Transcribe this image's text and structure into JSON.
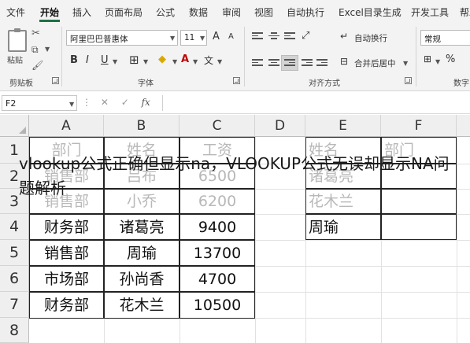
{
  "menu": {
    "tabs": [
      "文件",
      "开始",
      "插入",
      "页面布局",
      "公式",
      "数据",
      "审阅",
      "视图",
      "自动执行",
      "Excel目录生成",
      "开发工具",
      "帮助"
    ],
    "active_tab": "开始"
  },
  "ribbon": {
    "clipboard": {
      "paste_label": "粘贴",
      "group_label": "剪贴板"
    },
    "font": {
      "font_name": "阿里巴巴普惠体",
      "font_size": "11",
      "grow_label": "A",
      "shrink_label": "A",
      "bold": "B",
      "italic": "I",
      "underline": "U",
      "wen": "文",
      "group_label": "字体"
    },
    "alignment": {
      "wrap_text": "自动换行",
      "merge_center": "合并后居中",
      "group_label": "对齐方式"
    },
    "number": {
      "format": "常规",
      "group_label": "数字"
    }
  },
  "formula_bar": {
    "name_box": "F2",
    "fx": "fx",
    "formula": ""
  },
  "grid": {
    "columns": [
      "A",
      "B",
      "C",
      "D",
      "E",
      "F"
    ],
    "rows": [
      "1",
      "2",
      "3",
      "4",
      "5",
      "6",
      "7",
      "8"
    ],
    "cells": {
      "A1": "部门",
      "B1": "姓名",
      "C1": "工资",
      "A2": "销售部",
      "B2": "吕布",
      "C2": "6500",
      "A3": "销售部",
      "B3": "小乔",
      "C3": "6200",
      "A4": "财务部",
      "B4": "诸葛亮",
      "C4": "9400",
      "A5": "销售部",
      "B5": "周瑜",
      "C5": "13700",
      "A6": "市场部",
      "B6": "孙尚香",
      "C6": "4700",
      "A7": "财务部",
      "B7": "花木兰",
      "C7": "10500",
      "E1": "姓名",
      "F1": "部门",
      "E2": "诸葛亮",
      "E3": "花木兰",
      "E4": "周瑜"
    }
  },
  "overlay": {
    "title": "vlookup公式正确但显示na，VLOOKUP公式无误却显示NA问题解析"
  }
}
